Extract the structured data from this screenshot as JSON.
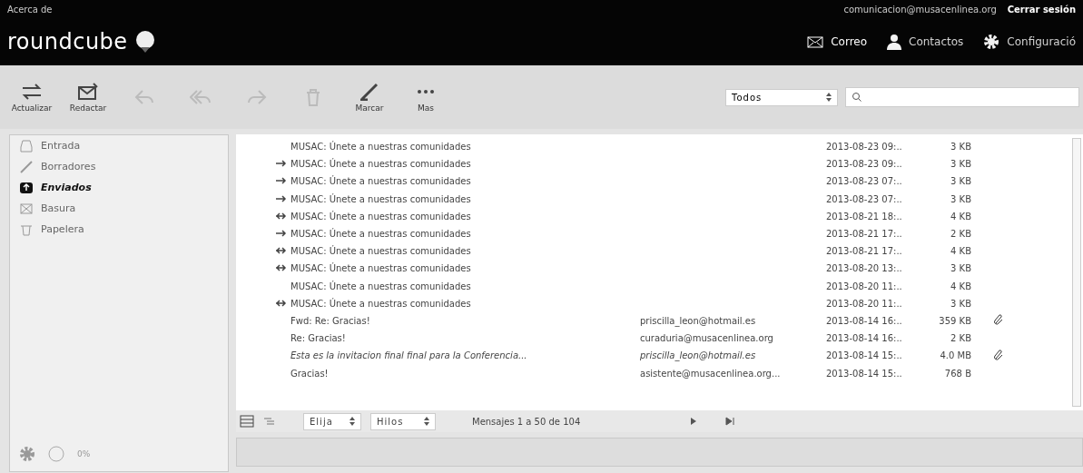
{
  "topbar": {
    "about": "Acerca de",
    "user": "comunicacion@musacenlinea.org",
    "logout": "Cerrar sesión",
    "logo": "roundcube"
  },
  "nav": [
    {
      "label": "Correo",
      "kind": "mail",
      "selected": true
    },
    {
      "label": "Contactos",
      "kind": "person",
      "selected": false
    },
    {
      "label": "Configuració",
      "kind": "gear",
      "selected": false
    }
  ],
  "toolbar": [
    {
      "label": "Actualizar",
      "kind": "refresh",
      "disabled": false
    },
    {
      "label": "Redactar",
      "kind": "compose",
      "disabled": false
    },
    {
      "kind": "reply",
      "disabled": true
    },
    {
      "kind": "replyall",
      "disabled": true
    },
    {
      "kind": "forward",
      "disabled": true
    },
    {
      "kind": "delete",
      "disabled": true
    },
    {
      "label": "Marcar",
      "kind": "pen",
      "disabled": false
    },
    {
      "label": "Mas",
      "kind": "dots",
      "disabled": false
    }
  ],
  "filter": {
    "value": "Todos"
  },
  "folders": [
    {
      "label": "Entrada",
      "kind": "inbox",
      "selected": false
    },
    {
      "label": "Borradores",
      "kind": "pencil",
      "selected": false
    },
    {
      "label": "Enviados",
      "kind": "sent",
      "selected": true
    },
    {
      "label": "Basura",
      "kind": "junk",
      "selected": false
    },
    {
      "label": "Papelera",
      "kind": "trash",
      "selected": false
    }
  ],
  "quota": "0%",
  "messages": [
    {
      "kind": "plain",
      "subject": "MUSAC: Únete a nuestras comunidades",
      "date": "2013-08-23 09:..",
      "size": "3 KB",
      "attachment": false,
      "italic": false
    },
    {
      "kind": "forwarded",
      "subject": "MUSAC: Únete a nuestras comunidades",
      "date": "2013-08-23 09:..",
      "size": "3 KB",
      "attachment": false,
      "italic": false
    },
    {
      "kind": "forwarded",
      "subject": "MUSAC: Únete a nuestras comunidades",
      "date": "2013-08-23 07:..",
      "size": "3 KB",
      "attachment": false,
      "italic": false
    },
    {
      "kind": "forwarded",
      "subject": "MUSAC: Únete a nuestras comunidades",
      "date": "2013-08-23 07:..",
      "size": "3 KB",
      "attachment": false,
      "italic": false
    },
    {
      "kind": "replied",
      "subject": "MUSAC: Únete a nuestras comunidades",
      "date": "2013-08-21 18:..",
      "size": "4 KB",
      "attachment": false,
      "italic": false
    },
    {
      "kind": "forwarded",
      "subject": "MUSAC: Únete a nuestras comunidades",
      "date": "2013-08-21 17:..",
      "size": "2 KB",
      "attachment": false,
      "italic": false
    },
    {
      "kind": "replied",
      "subject": "MUSAC: Únete a nuestras comunidades",
      "date": "2013-08-21 17:..",
      "size": "4 KB",
      "attachment": false,
      "italic": false
    },
    {
      "kind": "replied",
      "subject": "MUSAC: Únete a nuestras comunidades",
      "date": "2013-08-20 13:..",
      "size": "3 KB",
      "attachment": false,
      "italic": false
    },
    {
      "kind": "plain",
      "subject": "MUSAC: Únete a nuestras comunidades",
      "date": "2013-08-20 11:..",
      "size": "4 KB",
      "attachment": false,
      "italic": false
    },
    {
      "kind": "replied",
      "subject": "MUSAC: Únete a nuestras comunidades",
      "date": "2013-08-20 11:..",
      "size": "3 KB",
      "attachment": false,
      "italic": false
    },
    {
      "kind": "plain",
      "subject": "Fwd: Re: Gracias!",
      "to": "priscilla_leon@hotmail.es",
      "date": "2013-08-14 16:..",
      "size": "359 KB",
      "attachment": true,
      "italic": false
    },
    {
      "kind": "plain",
      "subject": "Re: Gracias!",
      "to": "curaduria@musacenlinea.org",
      "date": "2013-08-14 16:..",
      "size": "2 KB",
      "attachment": false,
      "italic": false
    },
    {
      "kind": "plain",
      "subject": "Esta es la invitacion final final para la Conferencia...",
      "to": "priscilla_leon@hotmail.es",
      "date": "2013-08-14 15:..",
      "size": "4.0 MB",
      "attachment": true,
      "italic": true
    },
    {
      "kind": "plain",
      "subject": "Gracias!",
      "to": "asistente@musacenlinea.org...",
      "date": "2013-08-14 15:..",
      "size": "768 B",
      "attachment": false,
      "italic": false
    }
  ],
  "list_footer": {
    "select": "Elija",
    "threads": "Hilos",
    "count": "Mensajes 1 a 50 de 104"
  }
}
